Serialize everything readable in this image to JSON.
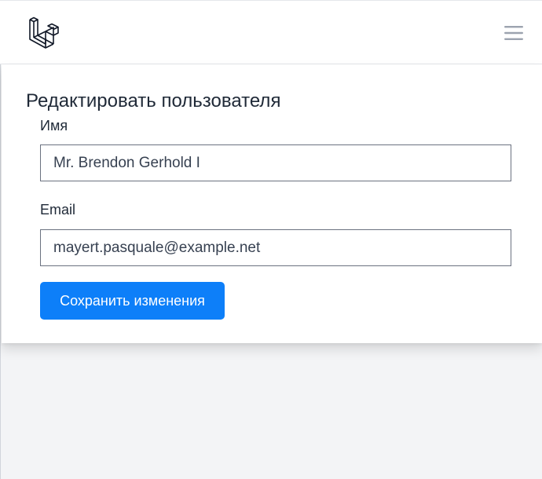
{
  "header": {
    "logo_icon": "laravel-logo-icon",
    "menu_icon": "hamburger-menu-icon"
  },
  "form": {
    "title": "Редактировать пользователя",
    "name_label": "Имя",
    "name_value": "Mr. Brendon Gerhold I",
    "email_label": "Email",
    "email_value": "mayert.pasquale@example.net",
    "submit_label": "Сохранить изменения"
  },
  "colors": {
    "primary": "#0d7ff9",
    "background": "#f3f4f6",
    "surface": "#ffffff",
    "text": "#1f2937",
    "icon_gray": "#9ca3af"
  }
}
